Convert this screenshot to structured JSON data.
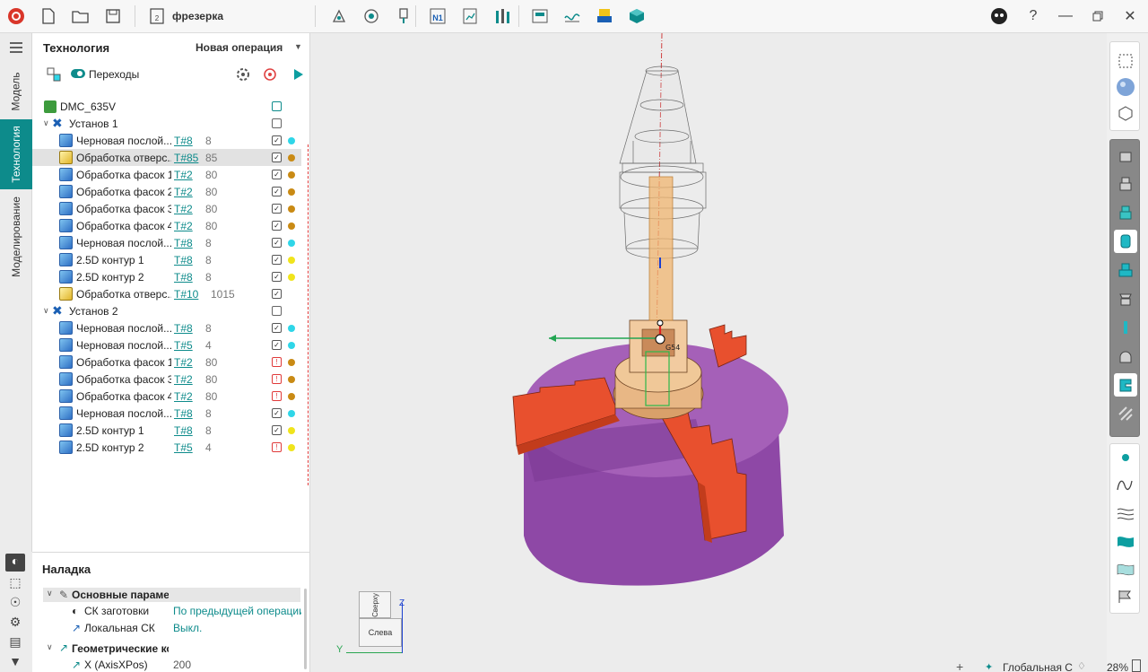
{
  "app": {
    "doc_title": "фрезерка"
  },
  "side_tabs": [
    "Модель",
    "Технология",
    "Моделирование"
  ],
  "tech_panel": {
    "title": "Технология",
    "new_operation": "Новая операция",
    "transitions_label": "Переходы",
    "machine": "DMC_635V",
    "setups": [
      {
        "label": "Установ 1",
        "ops": [
          {
            "name": "Черновая послой...",
            "tool": "T#8",
            "num": "8",
            "dot": "#2fd6e8",
            "icon": "blue"
          },
          {
            "name": "Обработка отверс...",
            "tool": "T#85",
            "num": "85",
            "dot": "#c98a14",
            "icon": "yellow",
            "selected": true
          },
          {
            "name": "Обработка фасок 1",
            "tool": "T#2",
            "num": "80",
            "dot": "#c98a14",
            "icon": "blue"
          },
          {
            "name": "Обработка фасок 2",
            "tool": "T#2",
            "num": "80",
            "dot": "#c98a14",
            "icon": "blue"
          },
          {
            "name": "Обработка фасок 3",
            "tool": "T#2",
            "num": "80",
            "dot": "#c98a14",
            "icon": "blue"
          },
          {
            "name": "Обработка фасок 4",
            "tool": "T#2",
            "num": "80",
            "dot": "#c98a14",
            "icon": "blue"
          },
          {
            "name": "Черновая послой...",
            "tool": "T#8",
            "num": "8",
            "dot": "#2fd6e8",
            "icon": "blue"
          },
          {
            "name": "2.5D контур 1",
            "tool": "T#8",
            "num": "8",
            "dot": "#f0e41c",
            "icon": "blue"
          },
          {
            "name": "2.5D контур 2",
            "tool": "T#8",
            "num": "8",
            "dot": "#f0e41c",
            "icon": "blue"
          },
          {
            "name": "Обработка отверс...",
            "tool": "T#10",
            "num": "1015",
            "dot": "",
            "icon": "yellow"
          }
        ]
      },
      {
        "label": "Установ 2",
        "ops": [
          {
            "name": "Черновая послой...",
            "tool": "T#8",
            "num": "8",
            "dot": "#2fd6e8",
            "icon": "blue"
          },
          {
            "name": "Черновая послой...",
            "tool": "T#5",
            "num": "4",
            "dot": "#2fd6e8",
            "icon": "blue"
          },
          {
            "name": "Обработка фасок 1",
            "tool": "T#2",
            "num": "80",
            "dot": "#c98a14",
            "icon": "blue"
          },
          {
            "name": "Обработка фасок 3",
            "tool": "T#2",
            "num": "80",
            "dot": "#c98a14",
            "icon": "blue"
          },
          {
            "name": "Обработка фасок 4",
            "tool": "T#2",
            "num": "80",
            "dot": "#c98a14",
            "icon": "blue"
          },
          {
            "name": "Черновая послой...",
            "tool": "T#8",
            "num": "8",
            "dot": "#2fd6e8",
            "icon": "blue"
          },
          {
            "name": "2.5D контур 1",
            "tool": "T#8",
            "num": "8",
            "dot": "#f0e41c",
            "icon": "blue"
          },
          {
            "name": "2.5D контур 2",
            "tool": "T#5",
            "num": "4",
            "dot": "#f0e41c",
            "icon": "blue"
          }
        ]
      }
    ]
  },
  "setup_panel": {
    "title": "Наладка",
    "group1": "Основные параметр",
    "rows": [
      {
        "label": "СК заготовки",
        "value": "По предыдущей операции"
      },
      {
        "label": "Локальная СК",
        "value": "Выкл."
      }
    ],
    "group2": "Геометрические кос",
    "x_label": "X (AxisXPos)",
    "x_value": "200"
  },
  "viewport": {
    "cube_top": "Сверху",
    "cube_left": "Слева",
    "axis_z": "Z",
    "axis_y": "Y",
    "point_label": "G54"
  },
  "status": {
    "cs": "Глобальная С",
    "zoom": "28%"
  },
  "colors": {
    "accent": "#0d8b8b",
    "chuck_body": "#8e48a6",
    "jaws": "#e8502e",
    "part": "#e8b785"
  }
}
